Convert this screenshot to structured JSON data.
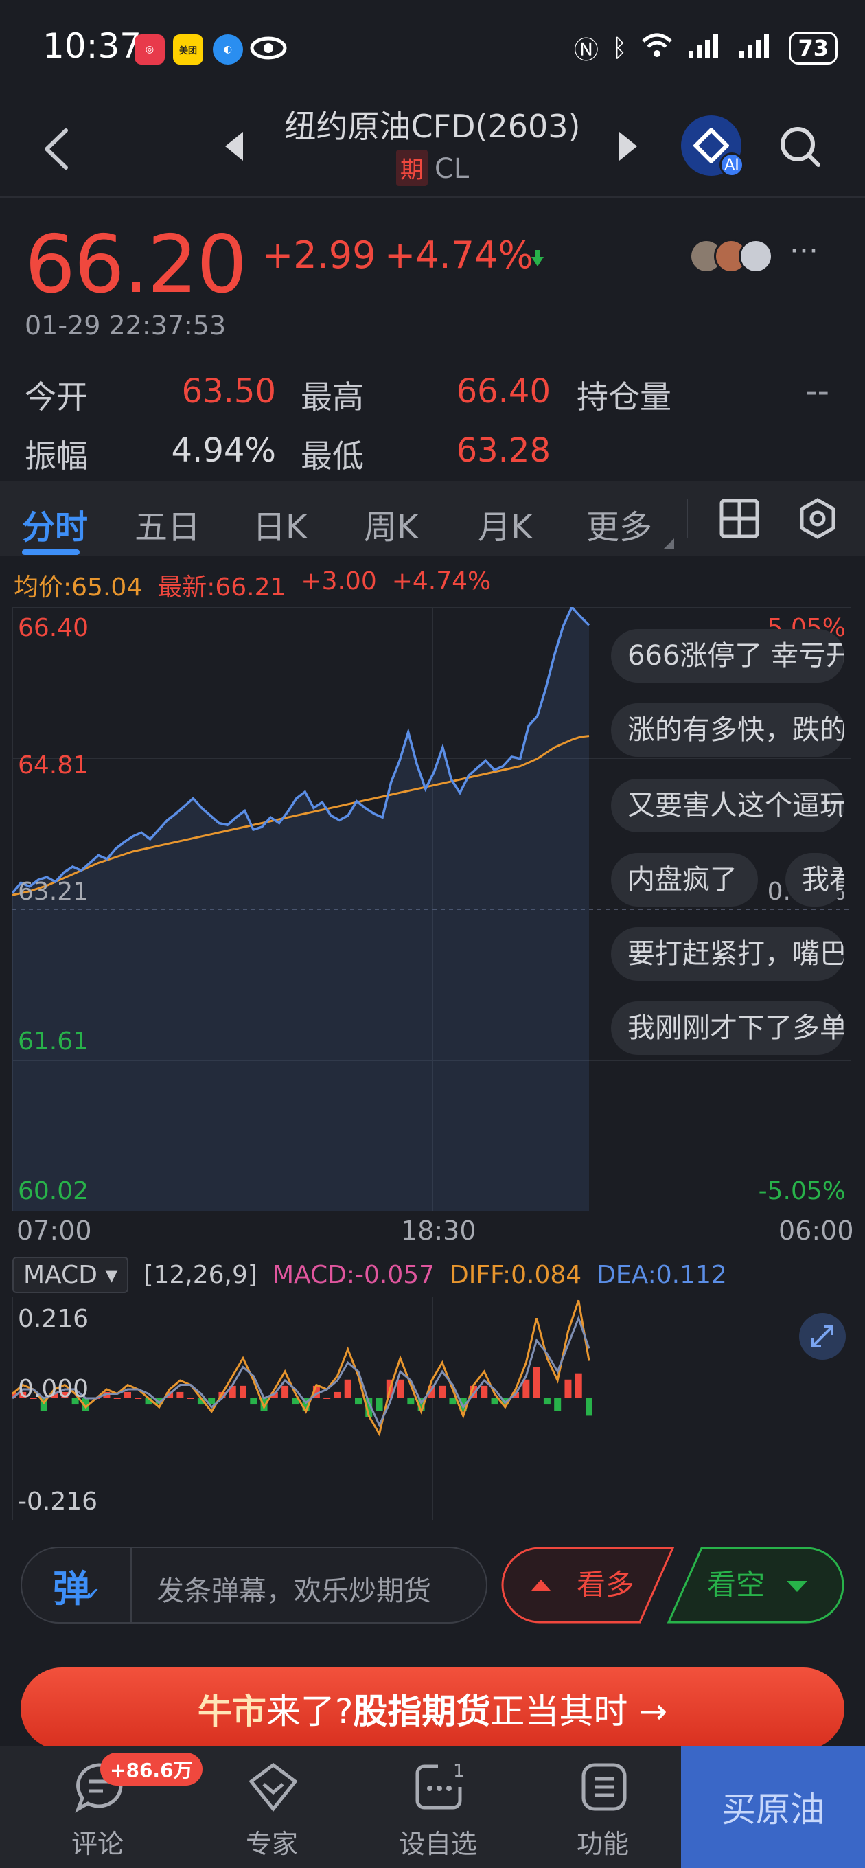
{
  "status_bar": {
    "time": "10:37",
    "app_badges": [
      "app-icon",
      "美团",
      "browser-icon",
      "eye-icon"
    ],
    "battery": "73"
  },
  "header": {
    "title": "纽约原油CFD(2603)",
    "tag": "期",
    "symbol": "CL",
    "ai_label": "AI"
  },
  "quote": {
    "price": "66.20",
    "change": "+2.99",
    "change_pct": "+4.74%",
    "datetime": "01-29 22:37:53",
    "more": "···",
    "stats": {
      "open_label": "今开",
      "open": "63.50",
      "high_label": "最高",
      "high": "66.40",
      "oi_label": "持仓量",
      "oi": "--",
      "amp_label": "振幅",
      "amp": "4.94%",
      "low_label": "最低",
      "low": "63.28"
    }
  },
  "tabs": [
    "分时",
    "五日",
    "日K",
    "周K",
    "月K",
    "更多"
  ],
  "legend": {
    "avg": "均价:65.04",
    "latest": "最新:66.21",
    "change": "+3.00",
    "pct": "+4.74%"
  },
  "chart_data": [
    {
      "type": "line",
      "y_ticks_left": [
        "66.40",
        "64.81",
        "63.21",
        "61.61",
        "60.02"
      ],
      "y_ticks_right": [
        "5.05%",
        "0.00%",
        "-5.05%"
      ],
      "x_ticks": [
        "07:00",
        "18:30",
        "06:00"
      ],
      "ylim": [
        60.02,
        66.4
      ],
      "baseline": 63.21,
      "series": [
        {
          "color": "#5b8ee6",
          "values": [
            63.38,
            63.49,
            63.45,
            63.52,
            63.55,
            63.5,
            63.6,
            63.66,
            63.62,
            63.7,
            63.78,
            63.74,
            63.85,
            63.92,
            63.98,
            64.02,
            63.95,
            64.05,
            64.15,
            64.22,
            64.3,
            64.38,
            64.28,
            64.2,
            64.12,
            64.1,
            64.18,
            64.25,
            64.05,
            64.08,
            64.18,
            64.12,
            64.24,
            64.38,
            64.45,
            64.28,
            64.34,
            64.2,
            64.15,
            64.2,
            64.35,
            64.28,
            64.22,
            64.18,
            64.55,
            64.78,
            65.08,
            64.74,
            64.48,
            64.66,
            64.92,
            64.58,
            64.44,
            64.62,
            64.7,
            64.78,
            64.68,
            64.72,
            64.82,
            64.8,
            65.15,
            65.25,
            65.55,
            65.9,
            66.2,
            66.4,
            66.3,
            66.21
          ]
        },
        {
          "color": "#e8962e",
          "values": [
            63.36,
            63.38,
            63.4,
            63.43,
            63.46,
            63.5,
            63.54,
            63.58,
            63.62,
            63.66,
            63.7,
            63.73,
            63.76,
            63.79,
            63.82,
            63.84,
            63.86,
            63.88,
            63.9,
            63.92,
            63.94,
            63.96,
            63.98,
            64.0,
            64.02,
            64.04,
            64.06,
            64.08,
            64.1,
            64.12,
            64.14,
            64.16,
            64.18,
            64.2,
            64.22,
            64.24,
            64.26,
            64.28,
            64.3,
            64.32,
            64.34,
            64.36,
            64.38,
            64.4,
            64.42,
            64.44,
            64.46,
            64.48,
            64.5,
            64.52,
            64.54,
            64.56,
            64.58,
            64.6,
            64.62,
            64.64,
            64.66,
            64.68,
            64.7,
            64.72,
            64.76,
            64.8,
            64.86,
            64.92,
            64.96,
            65.0,
            65.03,
            65.04
          ]
        }
      ]
    },
    {
      "type": "bar",
      "title": "MACD",
      "y_ticks": [
        "0.216",
        "0.000",
        "-0.216"
      ],
      "ylim": [
        -0.216,
        0.216
      ],
      "series": [
        {
          "color": "#e8962e",
          "values": [
            0.01,
            0.03,
            0.02,
            -0.01,
            0.02,
            0.03,
            0.01,
            -0.02,
            0.0,
            0.02,
            0.01,
            0.03,
            0.02,
            0.0,
            -0.02,
            0.02,
            0.04,
            0.03,
            0.0,
            -0.03,
            0.01,
            0.05,
            0.09,
            0.04,
            -0.02,
            0.02,
            0.06,
            0.01,
            -0.03,
            0.03,
            0.02,
            0.05,
            0.11,
            0.05,
            -0.04,
            -0.08,
            0.02,
            0.09,
            0.03,
            -0.03,
            0.04,
            0.08,
            0.02,
            -0.04,
            0.03,
            0.06,
            0.01,
            -0.02,
            0.02,
            0.08,
            0.18,
            0.09,
            0.04,
            0.15,
            0.22,
            0.084
          ]
        },
        {
          "color": "#7f8fb3",
          "values": [
            0.0,
            0.02,
            0.02,
            0.0,
            0.01,
            0.02,
            0.02,
            0.0,
            0.0,
            0.01,
            0.01,
            0.02,
            0.02,
            0.01,
            -0.01,
            0.01,
            0.03,
            0.03,
            0.01,
            -0.02,
            0.0,
            0.03,
            0.07,
            0.05,
            0.0,
            0.01,
            0.04,
            0.02,
            -0.01,
            0.01,
            0.02,
            0.04,
            0.08,
            0.06,
            -0.01,
            -0.06,
            -0.01,
            0.06,
            0.04,
            -0.01,
            0.02,
            0.06,
            0.03,
            -0.02,
            0.01,
            0.04,
            0.02,
            -0.01,
            0.01,
            0.05,
            0.13,
            0.1,
            0.06,
            0.12,
            0.18,
            0.112
          ]
        }
      ],
      "hist": [
        0.01,
        0.01,
        0.0,
        -0.02,
        0.01,
        0.01,
        -0.01,
        -0.02,
        0.0,
        0.01,
        0.0,
        0.01,
        0.0,
        -0.01,
        -0.01,
        0.01,
        0.01,
        0.0,
        -0.01,
        -0.01,
        0.01,
        0.02,
        0.02,
        -0.01,
        -0.02,
        0.01,
        0.02,
        -0.01,
        -0.02,
        0.02,
        0.0,
        0.01,
        0.03,
        -0.01,
        -0.03,
        -0.02,
        0.03,
        0.03,
        -0.01,
        -0.02,
        0.02,
        0.02,
        -0.01,
        -0.02,
        0.02,
        0.02,
        -0.01,
        -0.01,
        0.01,
        0.03,
        0.05,
        -0.01,
        -0.02,
        0.03,
        0.04,
        -0.028
      ]
    }
  ],
  "macd_params": {
    "select": "MACD",
    "params": "[12,26,9]",
    "macd": "MACD:-0.057",
    "diff": "DIFF:0.084",
    "dea": "DEA:0.112"
  },
  "danmu": [
    "666涨停了 幸亏开",
    "涨的有多快，跌的",
    "又要害人这个逼玩",
    "内盘疯了",
    "我看",
    "要打赶紧打，嘴巴",
    "我刚刚才下了多单"
  ],
  "bottom": {
    "danmu_icon": "弹",
    "danmu_placeholder": "发条弹幕，欢乐炒期货",
    "bull": "看多",
    "bear": "看空",
    "banner_1": "牛市",
    "banner_2": "来了? ",
    "banner_3": "股指期货",
    "banner_4": "正当其时 →"
  },
  "nav": {
    "comment": "评论",
    "comment_badge": "+86.6万",
    "expert": "专家",
    "watch": "设自选",
    "watch_count": "1",
    "func": "功能",
    "buy": "买原油"
  },
  "colors": {
    "up": "#f0483e",
    "down": "#28b24a",
    "accent": "#3e8ff7",
    "price_line": "#5b8ee6",
    "avg_line": "#e8962e",
    "macd": "#e0569e"
  }
}
